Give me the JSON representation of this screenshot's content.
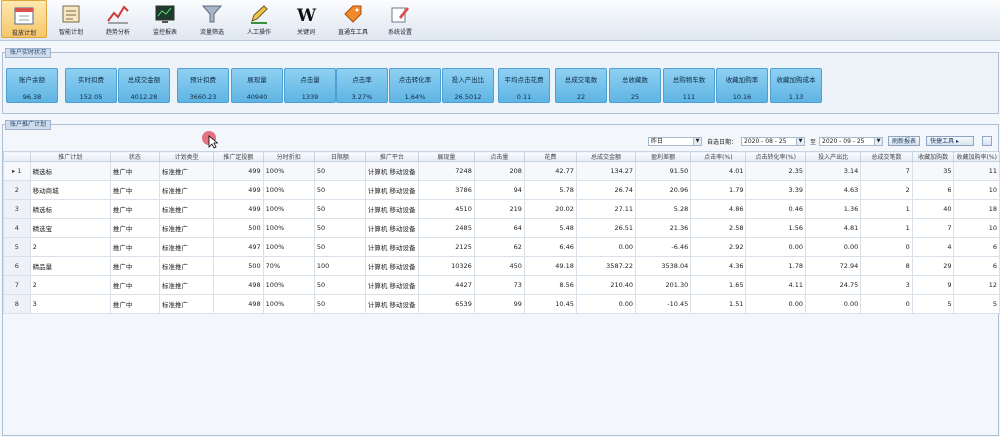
{
  "toolbar": [
    {
      "label": "投放计划",
      "icon": "calendar-icon",
      "active": true
    },
    {
      "label": "智能计划",
      "icon": "document-icon",
      "active": false
    },
    {
      "label": "趋势分析",
      "icon": "line-chart-icon",
      "active": false
    },
    {
      "label": "监控报表",
      "icon": "monitor-icon",
      "active": false
    },
    {
      "label": "流量筛选",
      "icon": "funnel-icon",
      "active": false
    },
    {
      "label": "人工操作",
      "icon": "pen-icon",
      "active": false
    },
    {
      "label": "关键词",
      "icon": "w-logo-icon",
      "active": false
    },
    {
      "label": "直通车工具",
      "icon": "tag-icon",
      "active": false
    },
    {
      "label": "系统设置",
      "icon": "edit-icon",
      "active": false
    }
  ],
  "summary": {
    "title": "账户实时状况",
    "stats": [
      {
        "label": "账户余额",
        "value": "96.38"
      },
      {
        "label": "实时扣费",
        "value": "152.05"
      },
      {
        "label": "总成交金额",
        "value": "4012.28"
      },
      {
        "label": "预计扣费",
        "value": "3660.23"
      },
      {
        "label": "展现量",
        "value": "40940"
      },
      {
        "label": "点击量",
        "value": "1339"
      },
      {
        "label": "点击率",
        "value": "3.27%"
      },
      {
        "label": "点击转化率",
        "value": "1.64%"
      },
      {
        "label": "投入产出比",
        "value": "26.5012"
      },
      {
        "label": "平均点击花费",
        "value": "0.11"
      },
      {
        "label": "总成交笔数",
        "value": "22"
      },
      {
        "label": "总收藏数",
        "value": "25"
      },
      {
        "label": "总购物车数",
        "value": "111"
      },
      {
        "label": "收藏加购率",
        "value": "10.16"
      },
      {
        "label": "收藏加购成本",
        "value": "1.13"
      }
    ]
  },
  "plans": {
    "title": "账户推广计划",
    "filters": {
      "period": "昨日",
      "date_label": "自选日期：",
      "date_from": "2020 - 08 - 25",
      "to_label": "至",
      "date_to": "2020 - 09 - 25",
      "refresh_button": "刷新报表",
      "action_button": "快捷工具"
    },
    "columns": [
      "推广计划",
      "状态",
      "计划类型",
      "推广定投额",
      "分时折扣",
      "日限额",
      "推广平台",
      "展现量",
      "点击量",
      "花费",
      "总成交金额",
      "盈利差额",
      "点击率(%)",
      "点击转化率(%)",
      "投入产出比",
      "总成交笔数",
      "收藏加购数",
      "收藏加购率(%)"
    ],
    "rows": [
      [
        "精选标",
        "推广中",
        "标准推广",
        "499",
        "100%",
        "50",
        "计算机 移动设备",
        "7248",
        "208",
        "42.77",
        "134.27",
        "91.50",
        "4.01",
        "2.35",
        "3.14",
        "7",
        "35",
        "11"
      ],
      [
        "移动商城",
        "推广中",
        "标准推广",
        "499",
        "100%",
        "50",
        "计算机 移动设备",
        "3786",
        "94",
        "5.78",
        "26.74",
        "20.96",
        "1.79",
        "3.39",
        "4.63",
        "2",
        "6",
        "10"
      ],
      [
        "精选标",
        "推广中",
        "标准推广",
        "499",
        "100%",
        "50",
        "计算机 移动设备",
        "4510",
        "219",
        "20.02",
        "27.11",
        "5.28",
        "4.86",
        "0.46",
        "1.36",
        "1",
        "40",
        "18"
      ],
      [
        "精选宝",
        "推广中",
        "标准推广",
        "500",
        "100%",
        "50",
        "计算机 移动设备",
        "2485",
        "64",
        "5.48",
        "26.51",
        "21.36",
        "2.58",
        "1.56",
        "4.81",
        "1",
        "7",
        "10"
      ],
      [
        "2",
        "推广中",
        "标准推广",
        "497",
        "100%",
        "50",
        "计算机 移动设备",
        "2125",
        "62",
        "6.46",
        "0.00",
        "-6.46",
        "2.92",
        "0.00",
        "0.00",
        "0",
        "4",
        "6"
      ],
      [
        "精品量",
        "推广中",
        "标准推广",
        "500",
        "70%",
        "100",
        "计算机 移动设备",
        "10326",
        "450",
        "49.18",
        "3587.22",
        "3538.04",
        "4.36",
        "1.78",
        "72.94",
        "8",
        "29",
        "6"
      ],
      [
        "2",
        "推广中",
        "标准推广",
        "498",
        "100%",
        "50",
        "计算机 移动设备",
        "4427",
        "73",
        "8.56",
        "210.40",
        "201.30",
        "1.65",
        "4.11",
        "24.75",
        "3",
        "9",
        "12"
      ],
      [
        "3",
        "推广中",
        "标准推广",
        "498",
        "100%",
        "50",
        "计算机 移动设备",
        "6539",
        "99",
        "10.45",
        "0.00",
        "-10.45",
        "1.51",
        "0.00",
        "0.00",
        "0",
        "5",
        "5"
      ]
    ]
  }
}
